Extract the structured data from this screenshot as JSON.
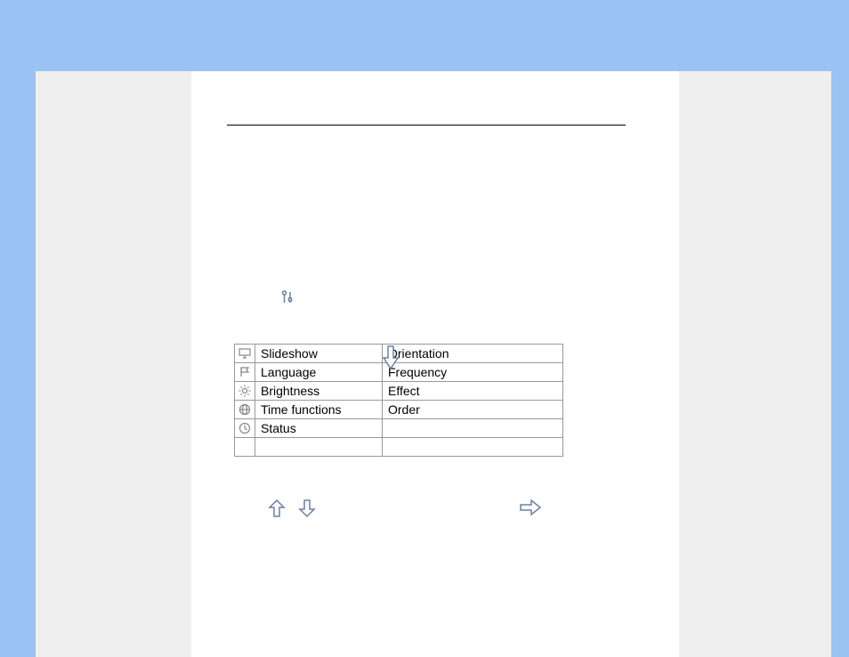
{
  "menu": {
    "rows": [
      {
        "icon": "monitor-icon",
        "label": "Slideshow",
        "right": "Orientation"
      },
      {
        "icon": "flag-icon",
        "label": "Language",
        "right": "Frequency"
      },
      {
        "icon": "sun-icon",
        "label": "Brightness",
        "right": "Effect"
      },
      {
        "icon": "globe-icon",
        "label": "Time functions",
        "right": "Order"
      },
      {
        "icon": "clock-icon",
        "label": "Status",
        "right": ""
      },
      {
        "icon": "",
        "label": "",
        "right": ""
      }
    ]
  }
}
